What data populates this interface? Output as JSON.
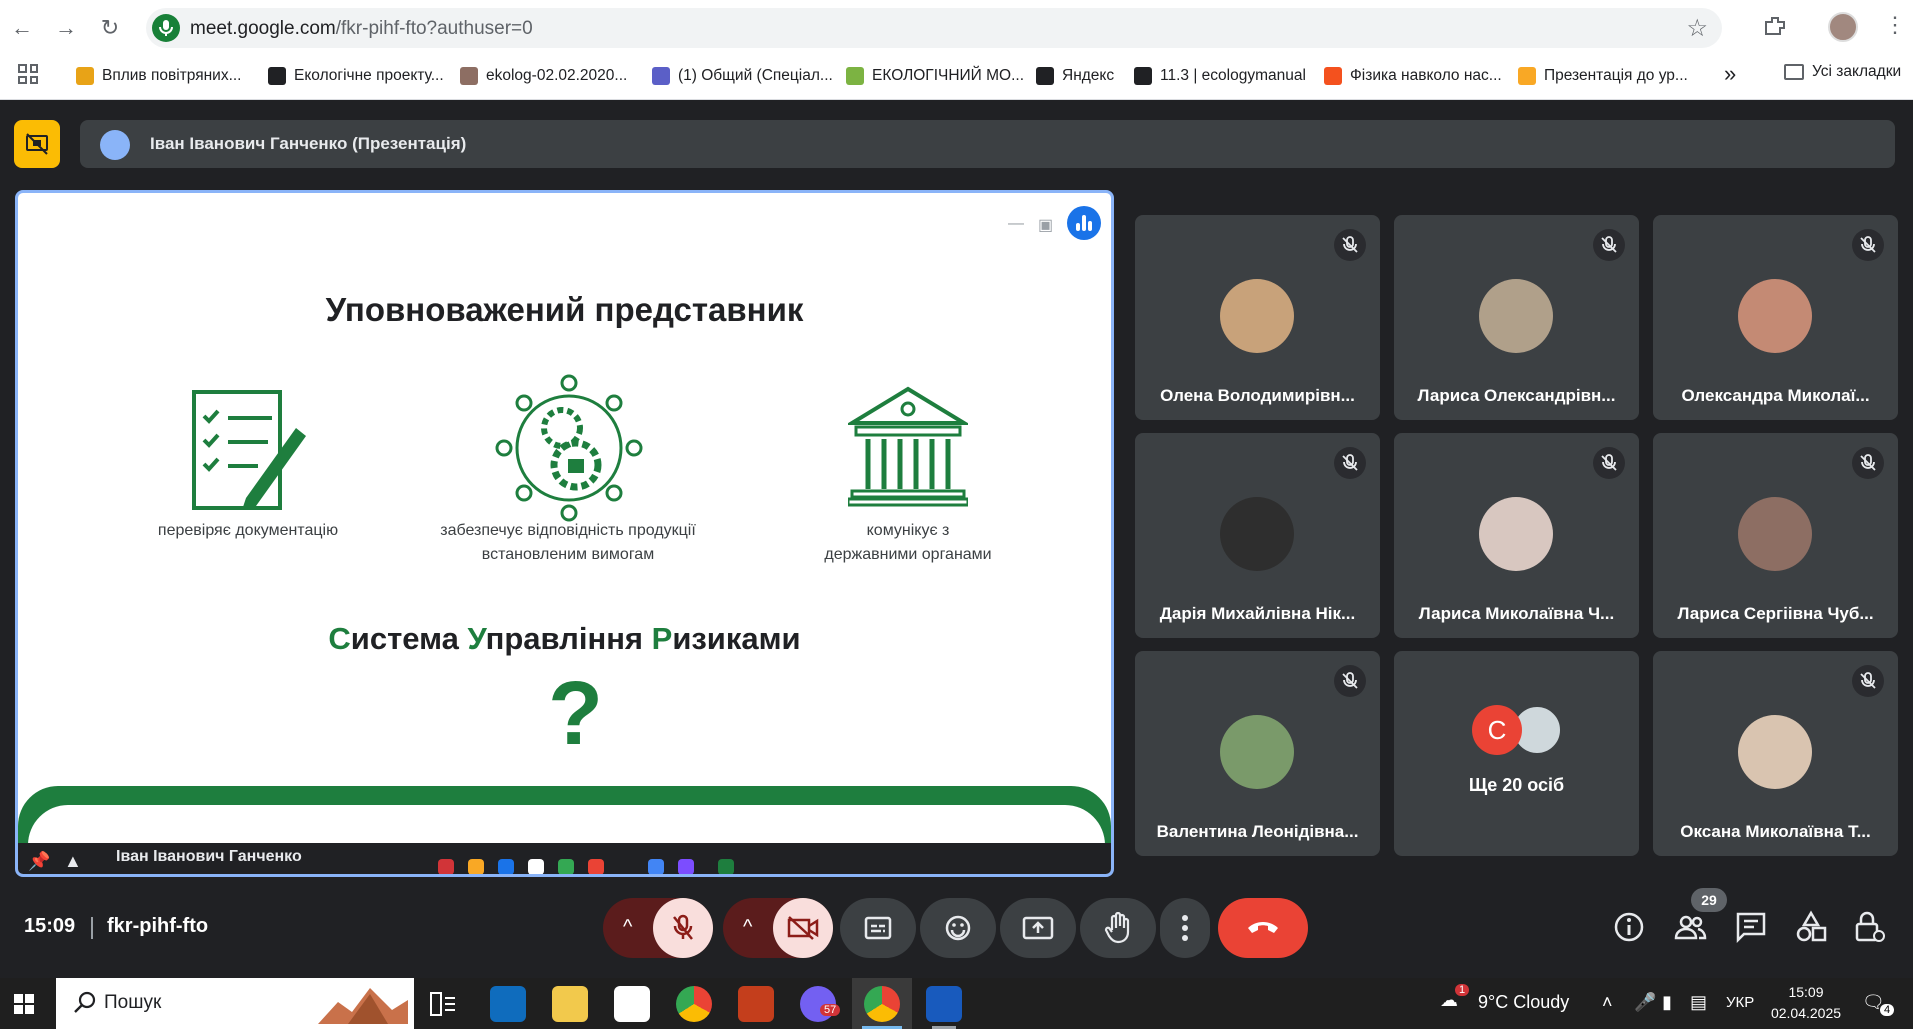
{
  "browser": {
    "url_host": "meet.google.com",
    "url_path": "/fkr-pihf-fto?authuser=0"
  },
  "bookmarks": [
    {
      "label": "Вплив повітряних...",
      "color": "#e8a317"
    },
    {
      "label": "Екологічне проекту...",
      "color": "#202124"
    },
    {
      "label": "ekolog-02.02.2020...",
      "color": "#8d6e63"
    },
    {
      "label": "(1) Общий (Спеціал...",
      "color": "#5b5fc7"
    },
    {
      "label": "ЕКОЛОГІЧНИЙ МО...",
      "color": "#7cb342"
    },
    {
      "label": "Яндекс",
      "color": "#202124"
    },
    {
      "label": "11.3 | ecologymanual",
      "color": "#202124"
    },
    {
      "label": "Фізика навколо нас...",
      "color": "#f4511e"
    },
    {
      "label": "Презентація до ур...",
      "color": "#f9a825"
    }
  ],
  "bookmarks_more": "»",
  "bookmarks_all": "Усі закладки",
  "presenter": {
    "name": "Іван Іванович Ганченко (Презентація)"
  },
  "slide": {
    "title": "Уповноважений представник",
    "captions": [
      {
        "line1": "перевіряє документацію",
        "line2": ""
      },
      {
        "line1": "забезпечує відповідність продукції",
        "line2": "встановленим вимогам"
      },
      {
        "line1": "комунікує з",
        "line2": "державними органами"
      }
    ],
    "subtitle_parts": [
      {
        "text": "С",
        "green": true
      },
      {
        "text": "истема ",
        "green": false
      },
      {
        "text": "У",
        "green": true
      },
      {
        "text": "правління ",
        "green": false
      },
      {
        "text": "Р",
        "green": true
      },
      {
        "text": "изиками",
        "green": false
      }
    ],
    "question": "?",
    "footer_name": "Іван Іванович Ганченко"
  },
  "participants": [
    {
      "name": "Олена Володимирівн...",
      "avatar_color": "#c8a27a",
      "muted": true
    },
    {
      "name": "Лариса Олександрівн...",
      "avatar_color": "#b0a08a",
      "muted": true
    },
    {
      "name": "Олександра Миколаї...",
      "avatar_color": "#c48a74",
      "muted": true
    },
    {
      "name": "Дарія Михайлівна Нік...",
      "avatar_color": "#2e2e2e",
      "muted": true
    },
    {
      "name": "Лариса Миколаївна Ч...",
      "avatar_color": "#d8c7c0",
      "muted": true
    },
    {
      "name": "Лариса Сергіівна Чуб...",
      "avatar_color": "#8d6e63",
      "muted": true
    },
    {
      "name": "Валентина Леонідівна...",
      "avatar_color": "#7a9a6a",
      "muted": true
    },
    {
      "name": "Оксана Миколаївна Т...",
      "avatar_color": "#d9c4b0",
      "muted": true
    }
  ],
  "more_people": {
    "initial": "С",
    "label": "Ще 20 осіб"
  },
  "toolbar": {
    "time": "15:09",
    "meeting_code": "fkr-pihf-fto",
    "people_count": "29",
    "chevron": "^"
  },
  "taskbar": {
    "search_placeholder": "Пошук",
    "weather_badge": "1",
    "weather": "9°C  Cloudy",
    "lang": "УКР",
    "time": "15:09",
    "date": "02.04.2025",
    "viber_badge": "57",
    "notif_count": "4"
  }
}
